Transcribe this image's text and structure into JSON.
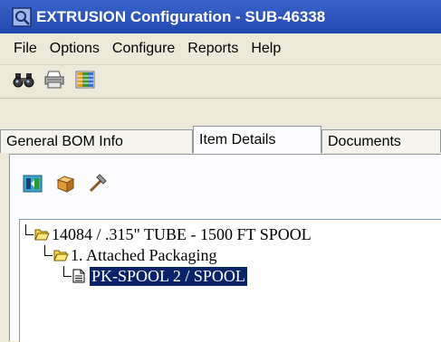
{
  "window": {
    "title": "EXTRUSION Configuration - SUB-46338",
    "title_bg": "#2a52be"
  },
  "menu": [
    "File",
    "Options",
    "Configure",
    "Reports",
    "Help"
  ],
  "toolbar": {
    "buttons": [
      "binoculars-icon",
      "printer-icon",
      "columns-icon"
    ]
  },
  "tabs": [
    {
      "label": "General BOM Info",
      "active": false
    },
    {
      "label": "Item Details",
      "active": true
    },
    {
      "label": "Documents",
      "active": false
    }
  ],
  "panel_toolbar": {
    "buttons": [
      "filter-icon",
      "box-icon",
      "hammer-icon"
    ]
  },
  "tree": {
    "nodes": [
      {
        "label": "14084 / .315\" TUBE - 1500 FT SPOOL",
        "icon": "open-folder-icon",
        "level": 0
      },
      {
        "label": "1. Attached Packaging",
        "icon": "open-folder-icon",
        "level": 1
      },
      {
        "label": "PK-SPOOL 2 / SPOOL",
        "icon": "document-icon",
        "level": 2,
        "selected": true
      }
    ],
    "selection_color": "#0a246a"
  }
}
